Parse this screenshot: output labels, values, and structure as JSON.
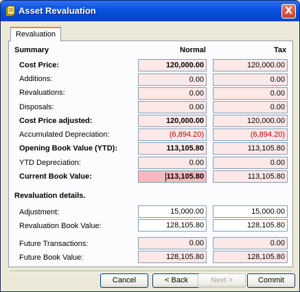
{
  "window": {
    "title": "Asset Revaluation",
    "close_glyph": "X"
  },
  "tabs": [
    {
      "label": "Revaluation"
    }
  ],
  "summary": {
    "heading": "Summary",
    "col_normal": "Normal",
    "col_tax": "Tax",
    "rows": [
      {
        "label": "Cost Price:",
        "normal": "120,000.00",
        "tax": "120,000.00"
      },
      {
        "label": "Additions:",
        "normal": "0.00",
        "tax": "0.00"
      },
      {
        "label": "Revaluations:",
        "normal": "0.00",
        "tax": "0.00"
      },
      {
        "label": "Disposals:",
        "normal": "0.00",
        "tax": "0.00"
      },
      {
        "label": "Cost Price adjusted:",
        "normal": "120,000.00",
        "tax": "120,000.00"
      },
      {
        "label": "Accumulated Depreciation:",
        "normal": "(6,894.20)",
        "tax": "(6,894.20)"
      },
      {
        "label": "Opening Book Value (YTD):",
        "normal": "113,105.80",
        "tax": "113,105.80"
      },
      {
        "label": "YTD Depreciation:",
        "normal": "0.00",
        "tax": "0.00"
      },
      {
        "label": "Current Book Value:",
        "normal": "113,105.80",
        "tax": "113,105.80"
      }
    ]
  },
  "details": {
    "heading": "Revaluation details.",
    "rows": [
      {
        "label": "Adjustment:",
        "normal": "15,000.00",
        "tax": "15,000.00"
      },
      {
        "label": "Revaluation Book Value:",
        "normal": "128,105.80",
        "tax": "128,105.80"
      },
      {
        "label": "Future Transactions:",
        "normal": "0.00",
        "tax": "0.00"
      },
      {
        "label": "Future Book Value:",
        "normal": "128,105.80",
        "tax": "128,105.80"
      }
    ]
  },
  "buttons": {
    "cancel": "Cancel",
    "back": "< Back",
    "next": "Next >",
    "commit": "Commit"
  },
  "colors": {
    "title_bar": "#0a55e0",
    "readonly_field": "#fde8e8",
    "negative_text": "#c00000",
    "active_field": "#f7b8c0"
  },
  "icons": {
    "title": "asset-icon",
    "close": "close-icon"
  }
}
